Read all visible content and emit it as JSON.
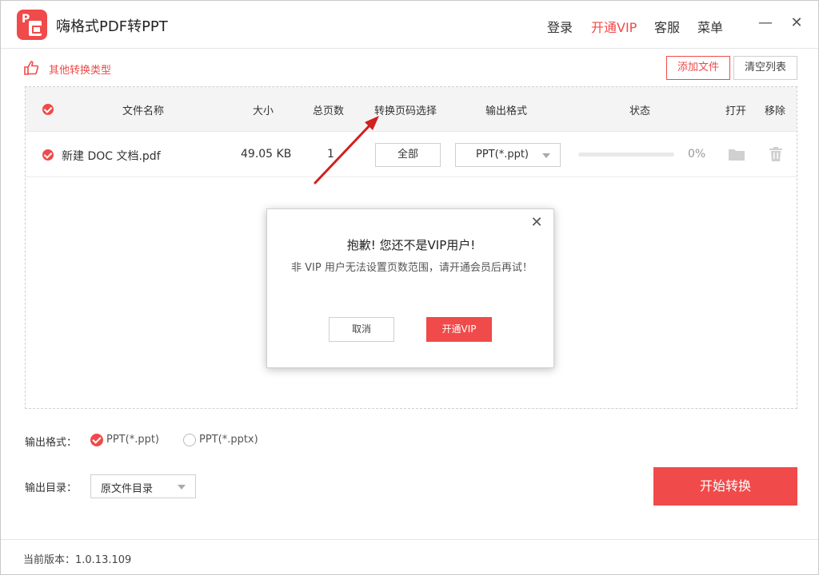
{
  "app": {
    "title": "嗨格式PDF转PPT",
    "logo_letter": "P"
  },
  "header_menu": {
    "login": "登录",
    "vip": "开通VIP",
    "service": "客服",
    "menu": "菜单"
  },
  "window_controls": {
    "minimize": "—",
    "close": "✕"
  },
  "toolbar": {
    "other_types": "其他转换类型",
    "add_file": "添加文件",
    "clear_list": "清空列表"
  },
  "table": {
    "columns": {
      "name": "文件名称",
      "size": "大小",
      "pages": "总页数",
      "page_select": "转换页码选择",
      "output_format": "输出格式",
      "status": "状态",
      "open": "打开",
      "remove": "移除"
    },
    "rows": [
      {
        "name": "新建 DOC 文档.pdf",
        "size": "49.05 KB",
        "pages": "1",
        "page_select": "全部",
        "format": "PPT(*.ppt)",
        "progress_percent": 0,
        "progress_text": "0%"
      }
    ]
  },
  "dialog": {
    "close": "✕",
    "title": "抱歉! 您还不是VIP用户!",
    "message": "非 VIP 用户无法设置页数范围，请开通会员后再试！",
    "cancel": "取消",
    "confirm": "开通VIP"
  },
  "options": {
    "format_label": "输出格式：",
    "format_ppt": "PPT(*.ppt)",
    "format_pptx": "PPT(*.pptx)",
    "selected_format": "ppt",
    "dir_label": "输出目录：",
    "dir_value": "原文件目录",
    "start": "开始转换"
  },
  "footer": {
    "version": "当前版本：1.0.13.109"
  },
  "colors": {
    "accent": "#f04a4a",
    "arrow": "#d21f1f"
  }
}
